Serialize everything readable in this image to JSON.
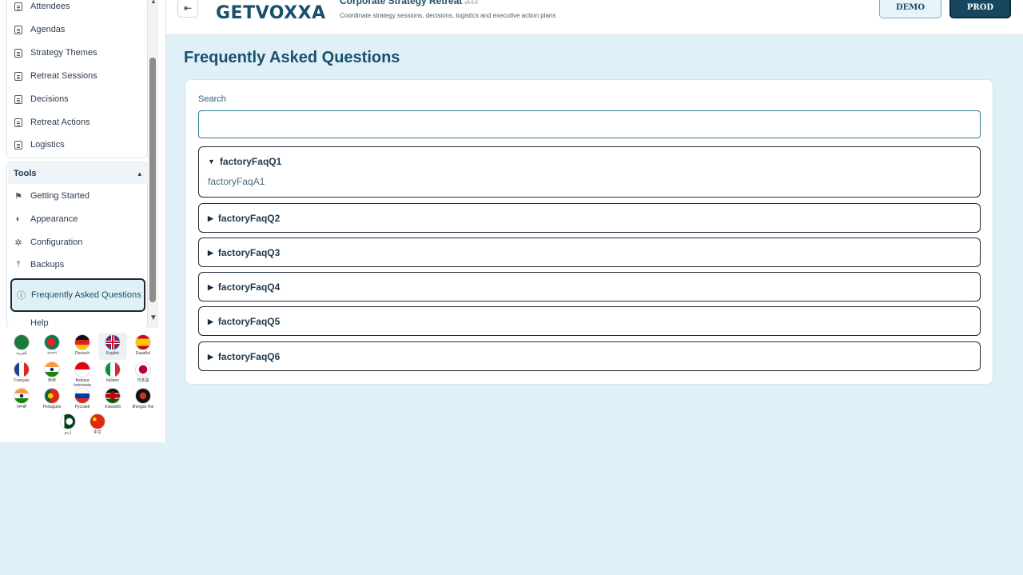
{
  "sidebar": {
    "items": [
      {
        "label": "Attendees"
      },
      {
        "label": "Agendas"
      },
      {
        "label": "Strategy Themes"
      },
      {
        "label": "Retreat Sessions"
      },
      {
        "label": "Decisions"
      },
      {
        "label": "Retreat Actions"
      },
      {
        "label": "Logistics"
      }
    ],
    "tools": {
      "heading": "Tools",
      "items": [
        {
          "label": "Getting Started"
        },
        {
          "label": "Appearance"
        },
        {
          "label": "Configuration"
        },
        {
          "label": "Backups"
        },
        {
          "label": "Frequently Asked Questions"
        },
        {
          "label": "Help"
        }
      ]
    },
    "languages": [
      {
        "label": "العربية",
        "flag": "saudi-arabia"
      },
      {
        "label": "বাংলা",
        "flag": "bangladesh"
      },
      {
        "label": "Deutsch",
        "flag": "germany"
      },
      {
        "label": "English",
        "flag": "united-kingdom",
        "selected": true
      },
      {
        "label": "Español",
        "flag": "spain"
      },
      {
        "label": "Français",
        "flag": "france"
      },
      {
        "label": "हिन्दी",
        "flag": "india"
      },
      {
        "label": "Bahasa Indonesia",
        "flag": "indonesia"
      },
      {
        "label": "Italiano",
        "flag": "italy"
      },
      {
        "label": "日本語",
        "flag": "japan"
      },
      {
        "label": "ਪੰਜਾਬੀ",
        "flag": "india"
      },
      {
        "label": "Português",
        "flag": "portugal"
      },
      {
        "label": "Русский",
        "flag": "russia"
      },
      {
        "label": "Kiswahili",
        "flag": "kenya"
      },
      {
        "label": "tlhIngan Hol",
        "flag": "klingon"
      },
      {
        "label": "اردو",
        "flag": "pakistan"
      },
      {
        "label": "中文",
        "flag": "china"
      }
    ]
  },
  "header": {
    "logo": "GETVOXXA",
    "title": "Corporate Strategy Retreat",
    "version": "v9.0.0",
    "subtitle": "Coordinate strategy sessions, decisions, logistics and executive action plans",
    "demo_label": "DEMO",
    "prod_label": "PROD"
  },
  "main": {
    "title": "Frequently Asked Questions",
    "search_label": "Search",
    "search_value": "",
    "faqs": [
      {
        "question": "factoryFaqQ1",
        "answer": "factoryFaqA1",
        "expanded": true
      },
      {
        "question": "factoryFaqQ2",
        "expanded": false
      },
      {
        "question": "factoryFaqQ3",
        "expanded": false
      },
      {
        "question": "factoryFaqQ4",
        "expanded": false
      },
      {
        "question": "factoryFaqQ5",
        "expanded": false
      },
      {
        "question": "factoryFaqQ6",
        "expanded": false
      }
    ]
  },
  "colors": {
    "primary": "#1a4f6e",
    "background": "#dff1f7",
    "prod_button": "#17465f"
  }
}
